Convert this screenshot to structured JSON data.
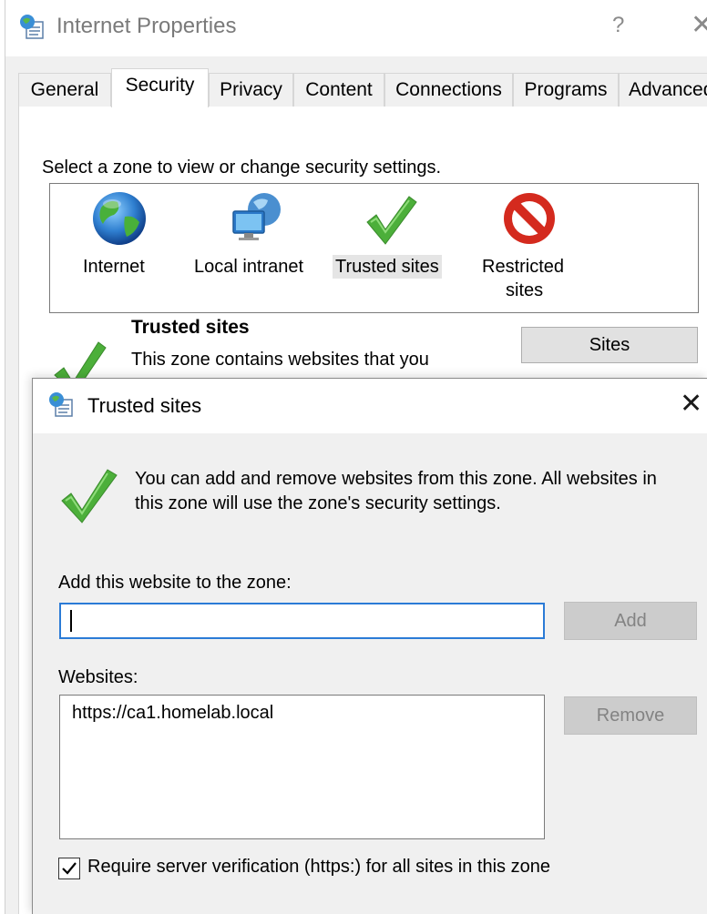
{
  "window": {
    "title": "Internet Properties",
    "help_glyph": "?",
    "close_glyph": "✕"
  },
  "tabs": [
    {
      "label": "General"
    },
    {
      "label": "Security"
    },
    {
      "label": "Privacy"
    },
    {
      "label": "Content"
    },
    {
      "label": "Connections"
    },
    {
      "label": "Programs"
    },
    {
      "label": "Advanced"
    }
  ],
  "security": {
    "zone_prompt": "Select a zone to view or change security settings.",
    "zones": [
      {
        "label": "Internet",
        "icon": "globe-icon"
      },
      {
        "label": "Local intranet",
        "icon": "intranet-icon"
      },
      {
        "label": "Trusted sites",
        "icon": "checkmark-icon",
        "selected": true
      },
      {
        "label": "Restricted",
        "label2": "sites",
        "icon": "restricted-icon"
      }
    ],
    "zone_heading": "Trusted sites",
    "zone_description": "This zone contains websites that you",
    "sites_button": "Sites"
  },
  "dialog": {
    "title": "Trusted sites",
    "close_glyph": "✕",
    "info_line1": "You can add and remove websites from this zone. All websites in",
    "info_line2": "this zone will use the zone's security settings.",
    "add_label": "Add this website to the zone:",
    "add_value": "",
    "add_button": "Add",
    "websites_label": "Websites:",
    "websites": [
      "https://ca1.homelab.local"
    ],
    "remove_button": "Remove",
    "require_verification_label": "Require server verification (https:) for all sites in this zone",
    "require_verification_checked": true
  },
  "colors": {
    "focus_border": "#2b7bd6",
    "check_green": "#4caf3a",
    "restricted_red": "#d42a1e"
  }
}
